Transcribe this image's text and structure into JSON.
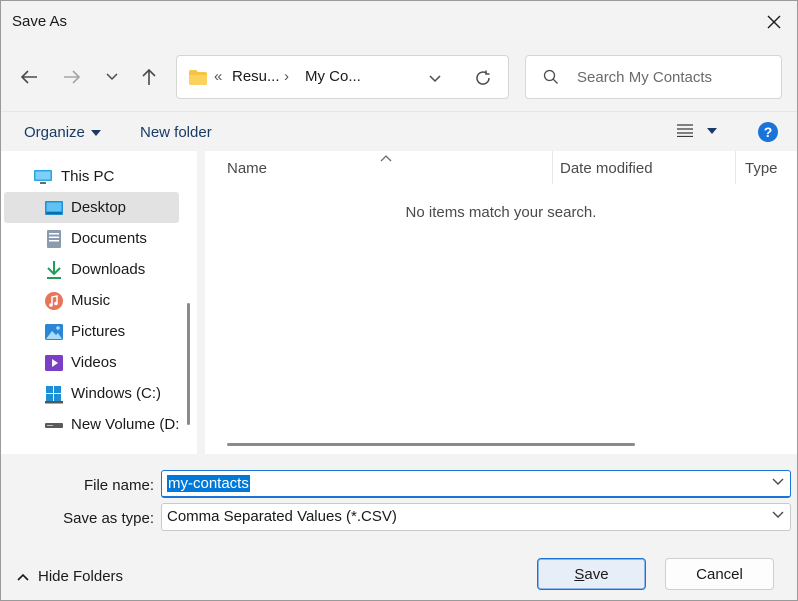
{
  "window": {
    "title": "Save As"
  },
  "nav": {
    "back_icon": "arrow-left-icon",
    "forward_icon": "arrow-right-icon",
    "recent_icon": "chevron-down-icon",
    "up_icon": "arrow-up-icon"
  },
  "address": {
    "overflow": "«",
    "crumbs": [
      "Resu...",
      "My Co..."
    ],
    "separator": "›"
  },
  "search": {
    "placeholder": "Search My Contacts"
  },
  "commands": {
    "organize": "Organize",
    "new_folder": "New folder",
    "help": "?"
  },
  "nav_pane": {
    "items": [
      {
        "label": "This PC",
        "icon": "monitor-icon",
        "selected": false
      },
      {
        "label": "Desktop",
        "icon": "desktop-icon",
        "selected": true
      },
      {
        "label": "Documents",
        "icon": "document-icon",
        "selected": false
      },
      {
        "label": "Downloads",
        "icon": "download-icon",
        "selected": false
      },
      {
        "label": "Music",
        "icon": "music-icon",
        "selected": false
      },
      {
        "label": "Pictures",
        "icon": "picture-icon",
        "selected": false
      },
      {
        "label": "Videos",
        "icon": "video-icon",
        "selected": false
      },
      {
        "label": "Windows (C:)",
        "icon": "drive-icon",
        "selected": false
      },
      {
        "label": "New Volume (D:",
        "icon": "drive-icon",
        "selected": false
      }
    ]
  },
  "file_list": {
    "columns": [
      "Name",
      "Date modified",
      "Type"
    ],
    "empty_message": "No items match your search."
  },
  "fields": {
    "file_name_label": "File name:",
    "file_name_value": "my-contacts",
    "save_type_label": "Save as type:",
    "save_type_value": "Comma Separated Values (*.CSV)"
  },
  "footer": {
    "hide_folders": "Hide Folders",
    "save": "Save",
    "cancel": "Cancel"
  },
  "colors": {
    "accent": "#1a73d9",
    "selection": "#0078d7",
    "dialog_bg": "#f3f3f3"
  }
}
